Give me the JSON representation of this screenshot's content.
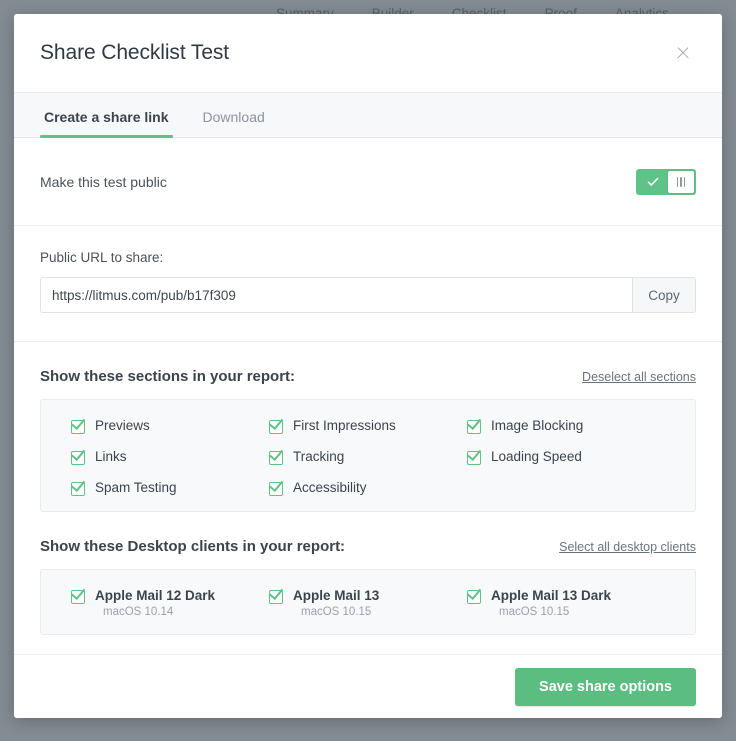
{
  "background": {
    "nav_items": [
      "Summary",
      "Builder",
      "Checklist",
      "Proof",
      "Analytics"
    ]
  },
  "modal": {
    "title": "Share Checklist Test",
    "close_label": "×",
    "tabs": [
      {
        "label": "Create a share link",
        "active": true
      },
      {
        "label": "Download",
        "active": false
      }
    ],
    "public_row": {
      "label": "Make this test public",
      "toggle_state": "on"
    },
    "url_section": {
      "label": "Public URL to share:",
      "value": "https://litmus.com/pub/b17f309",
      "placeholder": "https://",
      "copy_label": "Copy"
    },
    "sections_group": {
      "title": "Show these sections in your report:",
      "action_label": "Deselect all sections",
      "items": [
        {
          "label": "Previews",
          "checked": true
        },
        {
          "label": "First Impressions",
          "checked": true
        },
        {
          "label": "Image Blocking",
          "checked": true
        },
        {
          "label": "Links",
          "checked": true
        },
        {
          "label": "Tracking",
          "checked": true
        },
        {
          "label": "Loading Speed",
          "checked": true
        },
        {
          "label": "Spam Testing",
          "checked": true
        },
        {
          "label": "Accessibility",
          "checked": true
        }
      ]
    },
    "clients_group": {
      "title": "Show these Desktop clients in your report:",
      "action_label": "Select all desktop clients",
      "items": [
        {
          "label": "Apple Mail 12 Dark",
          "sub": "macOS 10.14",
          "checked": true
        },
        {
          "label": "Apple Mail 13",
          "sub": "macOS 10.15",
          "checked": true
        },
        {
          "label": "Apple Mail 13 Dark",
          "sub": "macOS 10.15",
          "checked": true
        }
      ]
    },
    "footer": {
      "save_label": "Save share options"
    }
  },
  "colors": {
    "accent_green": "#5fc387",
    "button_green": "#5bbd7f",
    "overlay": "#7c858f",
    "text_dark": "#3b444d",
    "text_muted": "#9aa2ab"
  }
}
